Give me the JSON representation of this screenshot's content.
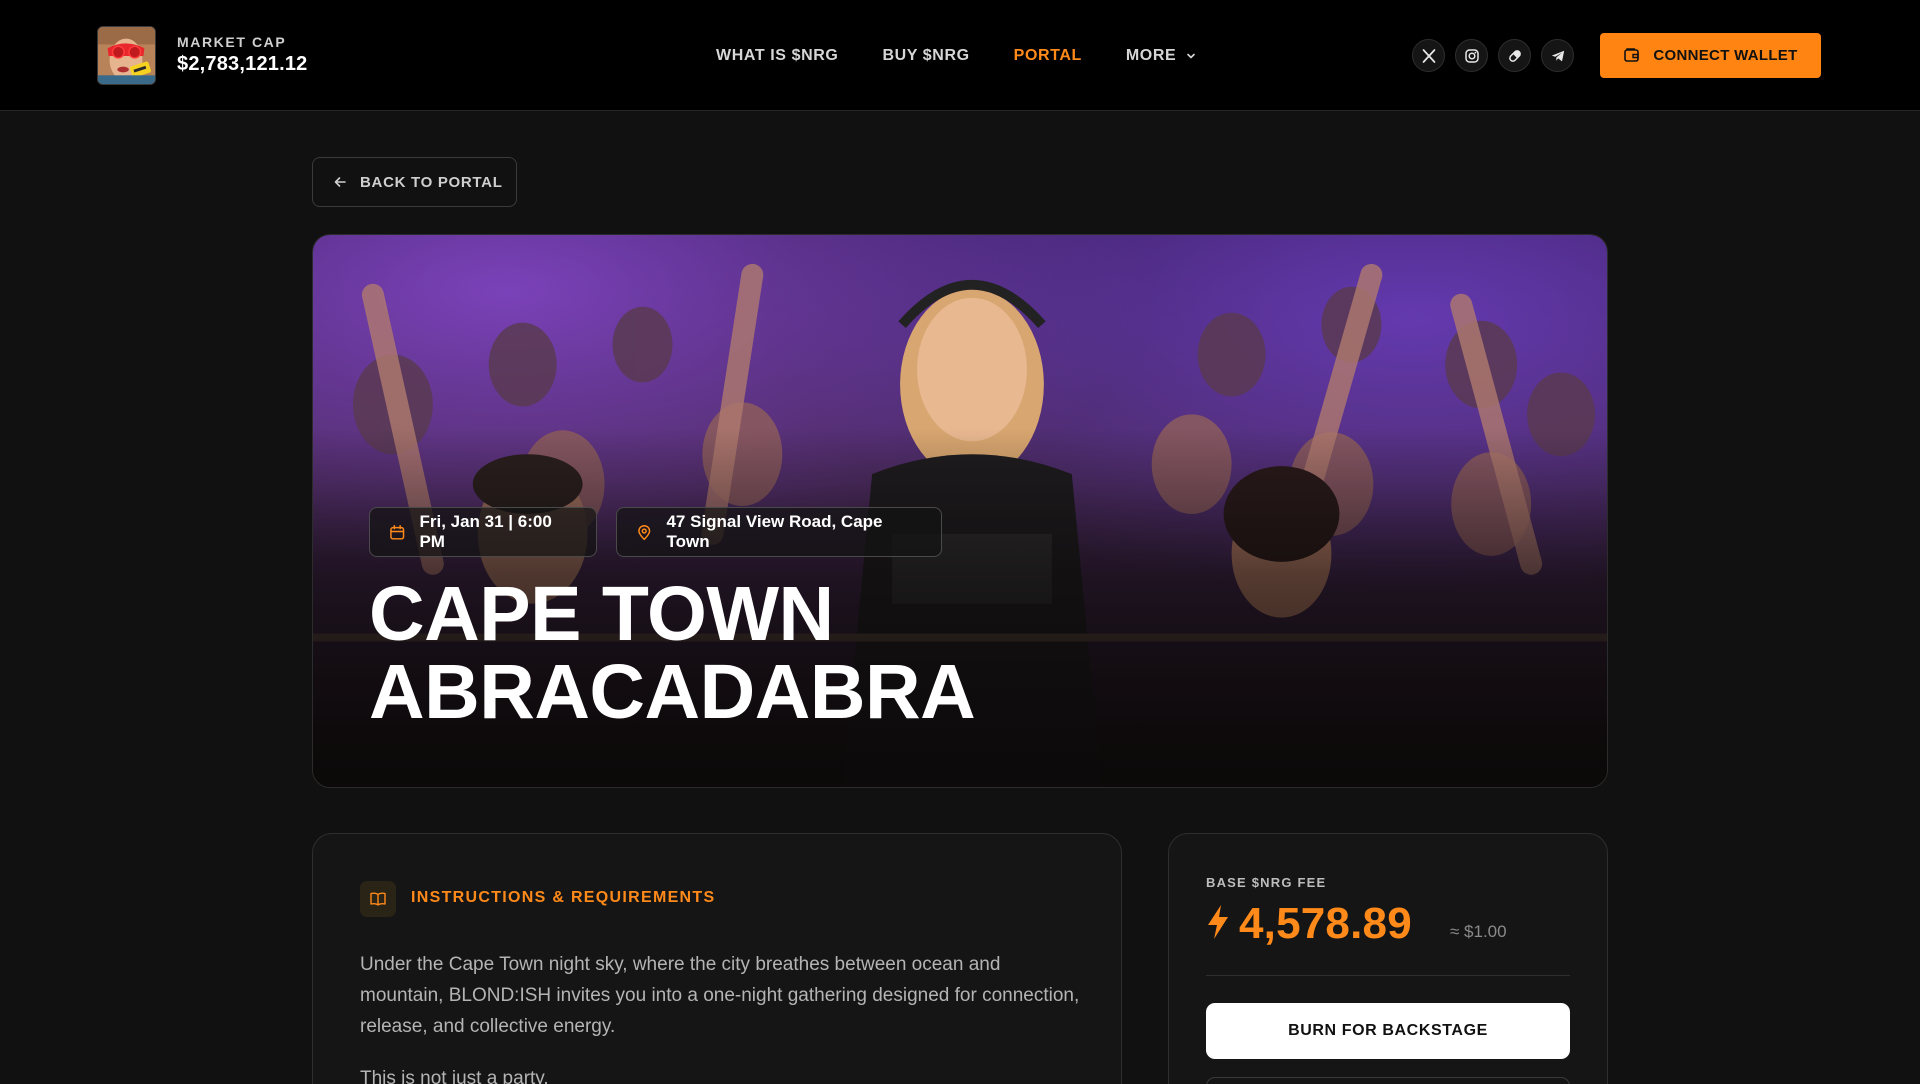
{
  "header": {
    "market_cap_label": "MARKET CAP",
    "market_cap_value": "$2,783,121.12",
    "nav": [
      {
        "label": "WHAT IS $NRG",
        "active": false
      },
      {
        "label": "BUY $NRG",
        "active": false
      },
      {
        "label": "PORTAL",
        "active": true
      },
      {
        "label": "MORE",
        "active": false,
        "icon": "chevron-down-icon"
      }
    ],
    "socials": [
      "x-icon",
      "instagram-icon",
      "pill-icon",
      "telegram-icon"
    ],
    "connect_wallet_label": "CONNECT WALLET",
    "accent_color": "#ff8412"
  },
  "back_button_label": "BACK TO PORTAL",
  "event": {
    "date": "Fri, Jan 31 | 6:00 PM",
    "location": "47 Signal View Road, Cape Town",
    "title_line1": "CAPE TOWN",
    "title_line2": "ABRACADABRA"
  },
  "instructions": {
    "heading": "INSTRUCTIONS & REQUIREMENTS",
    "paragraph1": "Under the Cape Town night sky, where the city breathes between ocean and mountain, BLOND:ISH invites you into a one-night gathering designed for connection, release, and collective energy.",
    "paragraph2": "This is not just a party."
  },
  "fee": {
    "label": "BASE $NRG FEE",
    "amount": "4,578.89",
    "usd_equivalent": "≈ $1.00",
    "burn_button_label": "BURN FOR BACKSTAGE"
  }
}
